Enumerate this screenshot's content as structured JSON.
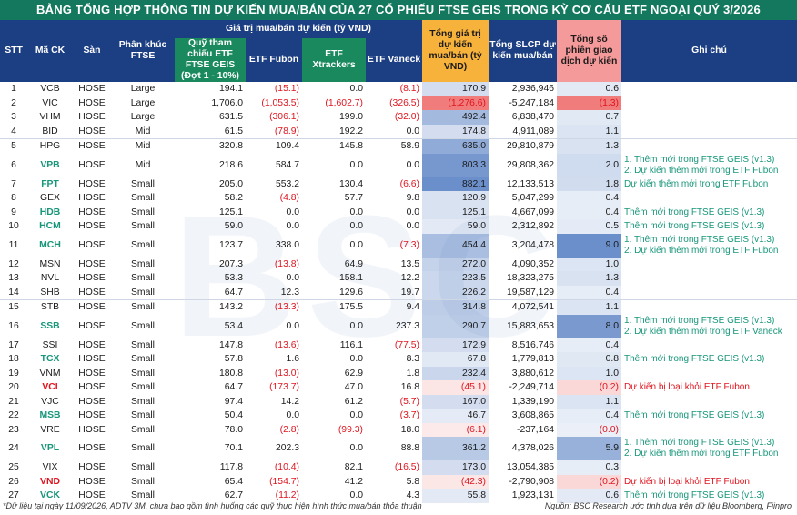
{
  "title": "BẢNG TỔNG HỢP THÔNG TIN DỰ KIẾN MUA/BÁN CỦA 27 CỔ PHIẾU FTSE GEIS TRONG KỲ CƠ CẤU ETF NGOẠI QUÝ 3/2026",
  "headers": {
    "stt": "STT",
    "ticker": "Mã CK",
    "exchange": "Sàn",
    "segment": "Phân khúc FTSE",
    "group": "Giá trị mua/bán dự kiến (tỷ VND)",
    "ftse_ref": "Quỹ tham chiếu ETF FTSE GEIS (Đợt 1 - 10%)",
    "fubon": "ETF Fubon",
    "xtrackers": "ETF Xtrackers",
    "vaneck": "ETF Vaneck",
    "total": "Tổng giá trị dự kiến mua/bán (tỷ VND)",
    "slcp": "Tổng SLCP dự kiến mua/bán",
    "sessions": "Tổng số phiên giao dịch dự kiến",
    "note": "Ghi chú"
  },
  "rows": [
    {
      "stt": "1",
      "ticker": "VCB",
      "exchange": "HOSE",
      "segment": "Large",
      "ftse": "194.1",
      "fubon": "(15.1)",
      "xtrackers": "0.0",
      "vaneck": "(8.1)",
      "total": "170.9",
      "slcp": "2,936,946",
      "sessions": "0.6",
      "note": [
        "",
        ""
      ],
      "hl": false
    },
    {
      "stt": "2",
      "ticker": "VIC",
      "exchange": "HOSE",
      "segment": "Large",
      "ftse": "1,706.0",
      "fubon": "(1,053.5)",
      "xtrackers": "(1,602.7)",
      "vaneck": "(326.5)",
      "total": "(1,276.6)",
      "slcp": "-5,247,184",
      "sessions": "(1.3)",
      "note": [
        "",
        ""
      ],
      "hl": false
    },
    {
      "stt": "3",
      "ticker": "VHM",
      "exchange": "HOSE",
      "segment": "Large",
      "ftse": "631.5",
      "fubon": "(306.1)",
      "xtrackers": "199.0",
      "vaneck": "(32.0)",
      "total": "492.4",
      "slcp": "6,838,470",
      "sessions": "0.7",
      "note": [
        "",
        ""
      ],
      "hl": false
    },
    {
      "stt": "4",
      "ticker": "BID",
      "exchange": "HOSE",
      "segment": "Mid",
      "ftse": "61.5",
      "fubon": "(78.9)",
      "xtrackers": "192.2",
      "vaneck": "0.0",
      "total": "174.8",
      "slcp": "4,911,089",
      "sessions": "1.1",
      "note": [
        "",
        ""
      ],
      "hl": false
    },
    {
      "stt": "5",
      "ticker": "HPG",
      "exchange": "HOSE",
      "segment": "Mid",
      "ftse": "320.8",
      "fubon": "109.4",
      "xtrackers": "145.8",
      "vaneck": "58.9",
      "total": "635.0",
      "slcp": "29,810,879",
      "sessions": "1.3",
      "note": [
        "",
        ""
      ],
      "hl": false
    },
    {
      "stt": "6",
      "ticker": "VPB",
      "exchange": "HOSE",
      "segment": "Mid",
      "ftse": "218.6",
      "fubon": "584.7",
      "xtrackers": "0.0",
      "vaneck": "0.0",
      "total": "803.3",
      "slcp": "29,808,362",
      "sessions": "2.0",
      "note": [
        "1. Thêm mới trong FTSE GEIS (v1.3)",
        "2. Dự kiến thêm mới trong ETF Fubon"
      ],
      "hl": true
    },
    {
      "stt": "7",
      "ticker": "FPT",
      "exchange": "HOSE",
      "segment": "Small",
      "ftse": "205.0",
      "fubon": "553.2",
      "xtrackers": "130.4",
      "vaneck": "(6.6)",
      "total": "882.1",
      "slcp": "12,133,513",
      "sessions": "1.8",
      "note": [
        "Dự kiến thêm mới trong ETF Fubon",
        ""
      ],
      "hl": true
    },
    {
      "stt": "8",
      "ticker": "GEX",
      "exchange": "HOSE",
      "segment": "Small",
      "ftse": "58.2",
      "fubon": "(4.8)",
      "xtrackers": "57.7",
      "vaneck": "9.8",
      "total": "120.9",
      "slcp": "5,047,299",
      "sessions": "0.4",
      "note": [
        "",
        ""
      ],
      "hl": false
    },
    {
      "stt": "9",
      "ticker": "HDB",
      "exchange": "HOSE",
      "segment": "Small",
      "ftse": "125.1",
      "fubon": "0.0",
      "xtrackers": "0.0",
      "vaneck": "0.0",
      "total": "125.1",
      "slcp": "4,667,099",
      "sessions": "0.4",
      "note": [
        "Thêm mới trong FTSE GEIS (v1.3)",
        ""
      ],
      "hl": true
    },
    {
      "stt": "10",
      "ticker": "HCM",
      "exchange": "HOSE",
      "segment": "Small",
      "ftse": "59.0",
      "fubon": "0.0",
      "xtrackers": "0.0",
      "vaneck": "0.0",
      "total": "59.0",
      "slcp": "2,312,892",
      "sessions": "0.5",
      "note": [
        "Thêm mới trong FTSE GEIS (v1.3)",
        ""
      ],
      "hl": true
    },
    {
      "stt": "11",
      "ticker": "MCH",
      "exchange": "HOSE",
      "segment": "Small",
      "ftse": "123.7",
      "fubon": "338.0",
      "xtrackers": "0.0",
      "vaneck": "(7.3)",
      "total": "454.4",
      "slcp": "3,204,478",
      "sessions": "9.0",
      "note": [
        "1. Thêm mới trong FTSE GEIS (v1.3)",
        "2. Dự kiến thêm mới trong ETF Fubon"
      ],
      "hl": true
    },
    {
      "stt": "12",
      "ticker": "MSN",
      "exchange": "HOSE",
      "segment": "Small",
      "ftse": "207.3",
      "fubon": "(13.8)",
      "xtrackers": "64.9",
      "vaneck": "13.5",
      "total": "272.0",
      "slcp": "4,090,352",
      "sessions": "1.0",
      "note": [
        "",
        ""
      ],
      "hl": false
    },
    {
      "stt": "13",
      "ticker": "NVL",
      "exchange": "HOSE",
      "segment": "Small",
      "ftse": "53.3",
      "fubon": "0.0",
      "xtrackers": "158.1",
      "vaneck": "12.2",
      "total": "223.5",
      "slcp": "18,323,275",
      "sessions": "1.3",
      "note": [
        "",
        ""
      ],
      "hl": false
    },
    {
      "stt": "14",
      "ticker": "SHB",
      "exchange": "HOSE",
      "segment": "Small",
      "ftse": "64.7",
      "fubon": "12.3",
      "xtrackers": "129.6",
      "vaneck": "19.7",
      "total": "226.2",
      "slcp": "19,587,129",
      "sessions": "0.4",
      "note": [
        "",
        ""
      ],
      "hl": false
    },
    {
      "stt": "15",
      "ticker": "STB",
      "exchange": "HOSE",
      "segment": "Small",
      "ftse": "143.2",
      "fubon": "(13.3)",
      "xtrackers": "175.5",
      "vaneck": "9.4",
      "total": "314.8",
      "slcp": "4,072,541",
      "sessions": "1.1",
      "note": [
        "",
        ""
      ],
      "hl": false
    },
    {
      "stt": "16",
      "ticker": "SSB",
      "exchange": "HOSE",
      "segment": "Small",
      "ftse": "53.4",
      "fubon": "0.0",
      "xtrackers": "0.0",
      "vaneck": "237.3",
      "total": "290.7",
      "slcp": "15,883,653",
      "sessions": "8.0",
      "note": [
        "1. Thêm mới trong FTSE GEIS (v1.3)",
        "2. Dự kiến thêm mới trong ETF Vaneck"
      ],
      "hl": true
    },
    {
      "stt": "17",
      "ticker": "SSI",
      "exchange": "HOSE",
      "segment": "Small",
      "ftse": "147.8",
      "fubon": "(13.6)",
      "xtrackers": "116.1",
      "vaneck": "(77.5)",
      "total": "172.9",
      "slcp": "8,516,746",
      "sessions": "0.4",
      "note": [
        "",
        ""
      ],
      "hl": false
    },
    {
      "stt": "18",
      "ticker": "TCX",
      "exchange": "HOSE",
      "segment": "Small",
      "ftse": "57.8",
      "fubon": "1.6",
      "xtrackers": "0.0",
      "vaneck": "8.3",
      "total": "67.8",
      "slcp": "1,779,813",
      "sessions": "0.8",
      "note": [
        "Thêm mới trong FTSE GEIS (v1.3)",
        ""
      ],
      "hl": true
    },
    {
      "stt": "19",
      "ticker": "VNM",
      "exchange": "HOSE",
      "segment": "Small",
      "ftse": "180.8",
      "fubon": "(13.0)",
      "xtrackers": "62.9",
      "vaneck": "1.8",
      "total": "232.4",
      "slcp": "3,880,612",
      "sessions": "1.0",
      "note": [
        "",
        ""
      ],
      "hl": false
    },
    {
      "stt": "20",
      "ticker": "VCI",
      "exchange": "HOSE",
      "segment": "Small",
      "ftse": "64.7",
      "fubon": "(173.7)",
      "xtrackers": "47.0",
      "vaneck": "16.8",
      "total": "(45.1)",
      "slcp": "-2,249,714",
      "sessions": "(0.2)",
      "note": [
        "Dự kiến bị loại khỏi ETF Fubon",
        ""
      ],
      "hl": "red"
    },
    {
      "stt": "21",
      "ticker": "VJC",
      "exchange": "HOSE",
      "segment": "Small",
      "ftse": "97.4",
      "fubon": "14.2",
      "xtrackers": "61.2",
      "vaneck": "(5.7)",
      "total": "167.0",
      "slcp": "1,339,190",
      "sessions": "1.1",
      "note": [
        "",
        ""
      ],
      "hl": false
    },
    {
      "stt": "22",
      "ticker": "MSB",
      "exchange": "HOSE",
      "segment": "Small",
      "ftse": "50.4",
      "fubon": "0.0",
      "xtrackers": "0.0",
      "vaneck": "(3.7)",
      "total": "46.7",
      "slcp": "3,608,865",
      "sessions": "0.4",
      "note": [
        "Thêm mới trong FTSE GEIS (v1.3)",
        ""
      ],
      "hl": true
    },
    {
      "stt": "23",
      "ticker": "VRE",
      "exchange": "HOSE",
      "segment": "Small",
      "ftse": "78.0",
      "fubon": "(2.8)",
      "xtrackers": "(99.3)",
      "vaneck": "18.0",
      "total": "(6.1)",
      "slcp": "-237,164",
      "sessions": "(0.0)",
      "note": [
        "",
        ""
      ],
      "hl": false
    },
    {
      "stt": "24",
      "ticker": "VPL",
      "exchange": "HOSE",
      "segment": "Small",
      "ftse": "70.1",
      "fubon": "202.3",
      "xtrackers": "0.0",
      "vaneck": "88.8",
      "total": "361.2",
      "slcp": "4,378,026",
      "sessions": "5.9",
      "note": [
        "1. Thêm mới trong FTSE GEIS (v1.3)",
        "2. Dự kiến thêm mới trong ETF Fubon"
      ],
      "hl": true
    },
    {
      "stt": "25",
      "ticker": "VIX",
      "exchange": "HOSE",
      "segment": "Small",
      "ftse": "117.8",
      "fubon": "(10.4)",
      "xtrackers": "82.1",
      "vaneck": "(16.5)",
      "total": "173.0",
      "slcp": "13,054,385",
      "sessions": "0.3",
      "note": [
        "",
        ""
      ],
      "hl": false
    },
    {
      "stt": "26",
      "ticker": "VND",
      "exchange": "HOSE",
      "segment": "Small",
      "ftse": "65.4",
      "fubon": "(154.7)",
      "xtrackers": "41.2",
      "vaneck": "5.8",
      "total": "(42.3)",
      "slcp": "-2,790,908",
      "sessions": "(0.2)",
      "note": [
        "Dự kiến bị loại khỏi ETF Fubon",
        ""
      ],
      "hl": "red"
    },
    {
      "stt": "27",
      "ticker": "VCK",
      "exchange": "HOSE",
      "segment": "Small",
      "ftse": "62.7",
      "fubon": "(11.2)",
      "xtrackers": "0.0",
      "vaneck": "4.3",
      "total": "55.8",
      "slcp": "1,923,131",
      "sessions": "0.6",
      "note": [
        "Thêm mới trong FTSE GEIS (v1.3)",
        ""
      ],
      "hl": true
    }
  ],
  "total_scale": {
    "min": -1276.6,
    "max": 882.1
  },
  "sessions_scale": {
    "min": -1.3,
    "max": 9.0
  },
  "colors": {
    "pos_bar": "#5b83c4",
    "neg_bar": "#ee6e6e",
    "header_blue": "#1c3e82",
    "header_green": "#1a8a5e",
    "title_green": "#14785e",
    "note_green": "#17967a",
    "note_red": "#e0141e"
  },
  "footnote": "*Dữ liệu tại ngày 11/09/2026, ADTV 3M, chưa bao gồm tình huống các quỹ thực hiện hình thức mua/bán thỏa thuận",
  "source": "Nguồn: BSC Research ước tính dựa trên dữ liệu Bloomberg, Fiinpro"
}
